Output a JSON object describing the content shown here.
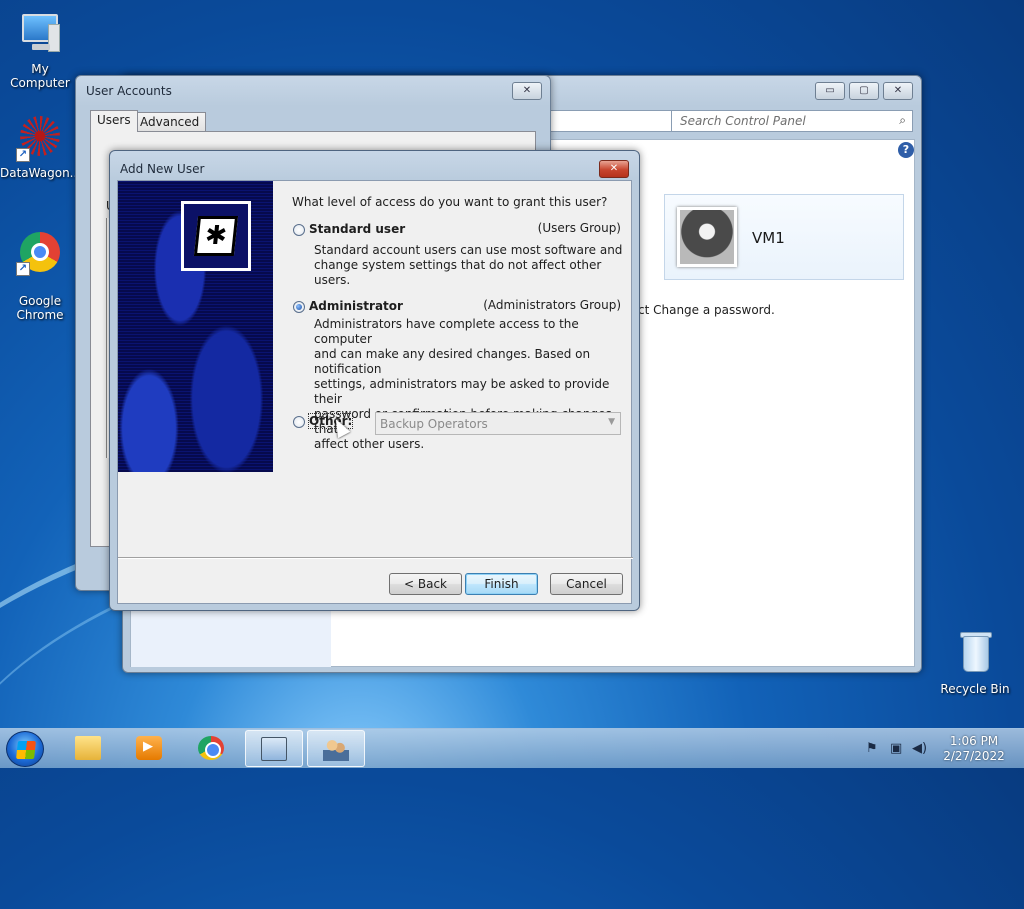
{
  "desktop": {
    "icons": [
      {
        "label": "My Computer"
      },
      {
        "label": "DataWagon..."
      },
      {
        "label": "Google\nChrome"
      },
      {
        "label": "Recycle Bin"
      }
    ],
    "shortcut_glyph": "↗"
  },
  "control_panel": {
    "search_placeholder": "Search Control Panel",
    "address_dropdown": "▼",
    "refresh_glyph": "⇆",
    "search_icon": "⌕",
    "help_glyph": "?",
    "user_tile_name": "VM1",
    "change_password_text": "ct Change a password.",
    "caption": {
      "minimize": "▭",
      "maximize": "▢",
      "close": "✕"
    }
  },
  "user_accounts": {
    "title": "User Accounts",
    "close_glyph": "✕",
    "tabs": [
      {
        "label": "Users"
      },
      {
        "label": "Advanced"
      }
    ],
    "partial_label": "U"
  },
  "dialog": {
    "title": "Add New User",
    "close_glyph": "✕",
    "question": "What level of access do you want to grant this user?",
    "options": [
      {
        "label": "Standard user",
        "group": "(Users Group)",
        "description": "Standard account users can use most software and\nchange system settings that do not affect other users.",
        "checked": false
      },
      {
        "label": "Administrator",
        "group": "(Administrators Group)",
        "description": "Administrators have complete access to the computer\nand can make any desired changes. Based on notification\nsettings, administrators may be asked to provide their\npassword or confirmation before making changes that\naffect other users.",
        "checked": true
      },
      {
        "label": "Other:",
        "checked": false
      }
    ],
    "other_group_select": "Backup Operators",
    "select_arrow": "▼",
    "buttons": {
      "back": "< Back",
      "finish": "Finish",
      "cancel": "Cancel"
    },
    "banner_icon_glyph": "✱"
  },
  "taskbar": {
    "clock_time": "1:06 PM",
    "clock_date": "2/27/2022",
    "tray_icons": [
      "flag-icon",
      "network-icon",
      "volume-icon"
    ],
    "tray_glyphs": [
      "⚑",
      "▣",
      "◀)"
    ]
  }
}
